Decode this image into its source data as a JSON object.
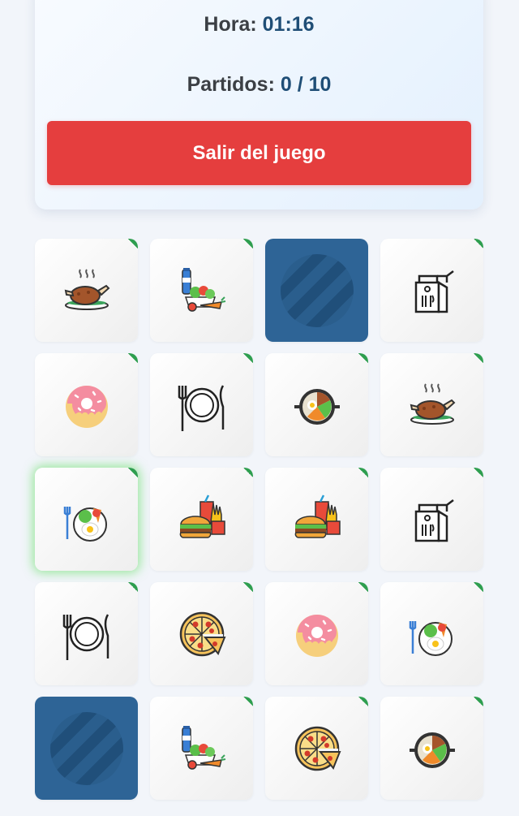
{
  "stats": {
    "time_label": "Hora:",
    "time_value": "01:16",
    "matches_label": "Partidos:",
    "matches_value": "0 / 10"
  },
  "actions": {
    "exit_label": "Salir del juego"
  },
  "board": {
    "columns": 4,
    "rows": 5,
    "cards": [
      {
        "state": "face-up",
        "icon": "roast-chicken-icon"
      },
      {
        "state": "face-up",
        "icon": "healthy-food-icon"
      },
      {
        "state": "face-down",
        "icon": "card-back-icon"
      },
      {
        "state": "face-up",
        "icon": "takeaway-bag-icon"
      },
      {
        "state": "face-up",
        "icon": "donut-icon"
      },
      {
        "state": "face-up",
        "icon": "plate-cutlery-icon"
      },
      {
        "state": "face-up",
        "icon": "bibimbap-pan-icon"
      },
      {
        "state": "face-up",
        "icon": "roast-chicken-icon"
      },
      {
        "state": "face-up",
        "icon": "breakfast-bowl-icon",
        "highlighted": true
      },
      {
        "state": "face-up",
        "icon": "fast-food-icon"
      },
      {
        "state": "face-up",
        "icon": "fast-food-icon"
      },
      {
        "state": "face-up",
        "icon": "takeaway-bag-icon"
      },
      {
        "state": "face-up",
        "icon": "plate-cutlery-icon"
      },
      {
        "state": "face-up",
        "icon": "pizza-icon"
      },
      {
        "state": "face-up",
        "icon": "donut-icon"
      },
      {
        "state": "face-up",
        "icon": "breakfast-bowl-icon"
      },
      {
        "state": "face-down",
        "icon": "card-back-icon"
      },
      {
        "state": "face-up",
        "icon": "healthy-food-icon"
      },
      {
        "state": "face-up",
        "icon": "pizza-icon"
      },
      {
        "state": "face-up",
        "icon": "bibimbap-pan-icon"
      }
    ]
  },
  "colors": {
    "exit_button": "#e53e3e",
    "card_back": "#2e6496",
    "stat_value": "#1f4e76",
    "card_corner": "#2e9e4f",
    "highlight_glow": "#5adc5a"
  }
}
